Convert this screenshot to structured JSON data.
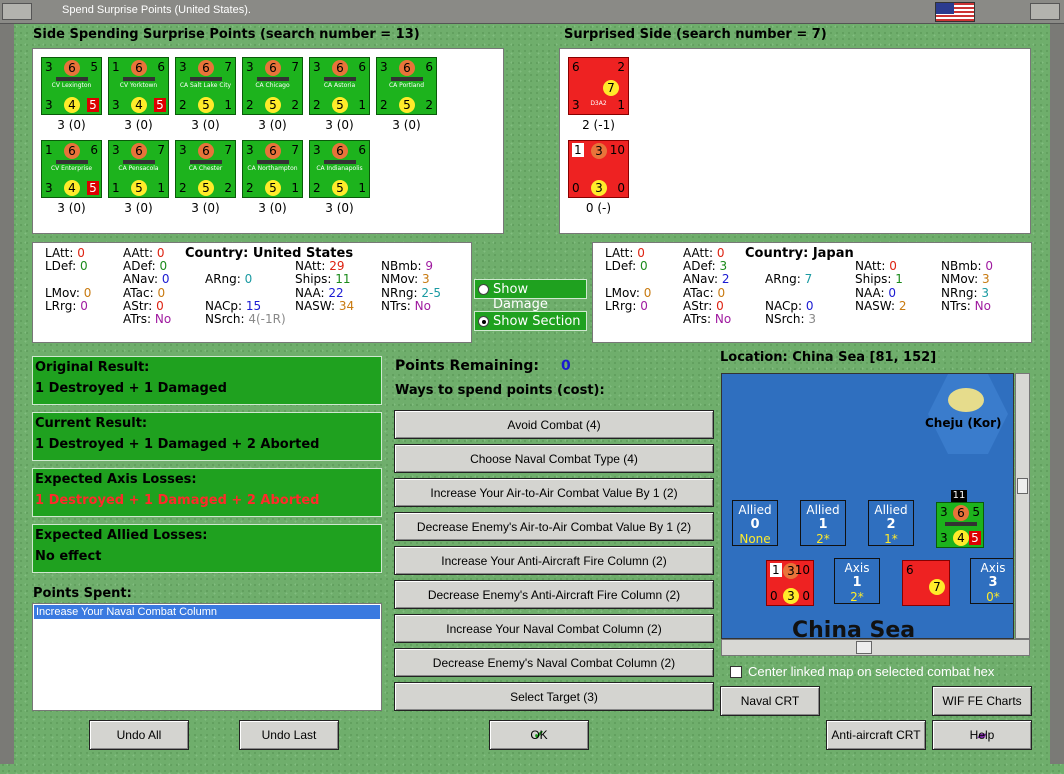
{
  "window": {
    "title": "Spend Surprise Points (United States)."
  },
  "side_spending": {
    "header": "Side Spending Surprise Points (search number = 13)",
    "units": [
      {
        "name": "CV Lexington",
        "tl": "3",
        "mid": "6",
        "tr": "5",
        "bl": "3",
        "bmid": "4",
        "br": "5",
        "label": "3 (0)",
        "red": true
      },
      {
        "name": "CV Yorktown",
        "tl": "1",
        "mid": "6",
        "tr": "6",
        "bl": "3",
        "bmid": "4",
        "br": "5",
        "label": "3 (0)",
        "red": true
      },
      {
        "name": "CA Salt Lake City",
        "tl": "3",
        "mid": "6",
        "tr": "7",
        "bl": "2",
        "bmid": "5",
        "br": "1",
        "label": "3 (0)"
      },
      {
        "name": "CA Chicago",
        "tl": "3",
        "mid": "6",
        "tr": "7",
        "bl": "2",
        "bmid": "5",
        "br": "2",
        "label": "3 (0)"
      },
      {
        "name": "CA Astoria",
        "tl": "3",
        "mid": "6",
        "tr": "6",
        "bl": "2",
        "bmid": "5",
        "br": "1",
        "label": "3 (0)"
      },
      {
        "name": "CA Portland",
        "tl": "3",
        "mid": "6",
        "tr": "6",
        "bl": "2",
        "bmid": "5",
        "br": "2",
        "label": "3 (0)"
      },
      {
        "name": "CV Enterprise",
        "tl": "1",
        "mid": "6",
        "tr": "6",
        "bl": "3",
        "bmid": "4",
        "br": "5",
        "label": "3 (0)",
        "red": true
      },
      {
        "name": "CA Pensacola",
        "tl": "3",
        "mid": "6",
        "tr": "7",
        "bl": "1",
        "bmid": "5",
        "br": "1",
        "label": "3 (0)"
      },
      {
        "name": "CA Chester",
        "tl": "3",
        "mid": "6",
        "tr": "7",
        "bl": "2",
        "bmid": "5",
        "br": "2",
        "label": "3 (0)"
      },
      {
        "name": "CA Northampton",
        "tl": "3",
        "mid": "6",
        "tr": "7",
        "bl": "2",
        "bmid": "5",
        "br": "1",
        "label": "3 (0)"
      },
      {
        "name": "CA Indianapolis",
        "tl": "3",
        "mid": "6",
        "tr": "6",
        "bl": "2",
        "bmid": "5",
        "br": "1",
        "label": "3 (0)"
      }
    ]
  },
  "surprised": {
    "header": "Surprised Side (search number = 7)",
    "units": [
      {
        "name": "D3A2",
        "tl": "6",
        "tr": "2",
        "bl": "3",
        "bmid": "7",
        "br": "1",
        "label": "2 (-1)"
      },
      {
        "name": "",
        "tl": "1",
        "mid": "3",
        "tr": "10",
        "bl": "0",
        "bmid": "3",
        "br": "0",
        "label": "0 (-)"
      }
    ]
  },
  "stats_us": {
    "country_label": "Country:",
    "country": "United States",
    "LAtt": "0",
    "LDef": "0",
    "LMov": "0",
    "LRrg": "0",
    "AAtt": "0",
    "ADef": "0",
    "ANav": "0",
    "ATac": "0",
    "AStr": "0",
    "ATrs": "No",
    "ARng": "0",
    "NACp": "15",
    "NSrch": "4(-1R)",
    "NAtt": "29",
    "Ships": "11",
    "NAA": "22",
    "NASW": "34",
    "NBmb": "9",
    "NMov": "3",
    "NRng": "2-5",
    "NTrs": "No"
  },
  "stats_jp": {
    "country_label": "Country:",
    "country": "Japan",
    "LAtt": "0",
    "LDef": "0",
    "LMov": "0",
    "LRrg": "0",
    "AAtt": "0",
    "ADef": "3",
    "ANav": "2",
    "ATac": "0",
    "AStr": "0",
    "ATrs": "No",
    "ARng": "7",
    "NACp": "0",
    "NSrch": "3",
    "NAtt": "0",
    "Ships": "1",
    "NAA": "0",
    "NASW": "2",
    "NBmb": "0",
    "NMov": "3",
    "NRng": "3",
    "NTrs": "No"
  },
  "labels": {
    "LAtt": "LAtt:",
    "LDef": "LDef:",
    "LMov": "LMov:",
    "LRrg": "LRrg:",
    "AAtt": "AAtt:",
    "ADef": "ADef:",
    "ANav": "ANav:",
    "ATac": "ATac:",
    "AStr": "AStr:",
    "ATrs": "ATrs:",
    "ARng": "ARng:",
    "NACp": "NACp:",
    "NSrch": "NSrch:",
    "NAtt": "NAtt:",
    "Ships": "Ships:",
    "NAA": "NAA:",
    "NASW": "NASW:",
    "NBmb": "NBmb:",
    "NMov": "NMov:",
    "NRng": "NRng:",
    "NTrs": "NTrs:"
  },
  "toggles": {
    "show_damage": "Show Damage",
    "show_section": "Show Section"
  },
  "results": {
    "original_label": "Original Result:",
    "original": "1 Destroyed + 1 Damaged",
    "current_label": "Current Result:",
    "current": "1 Destroyed + 1 Damaged + 2 Aborted",
    "axis_label": "Expected Axis Losses:",
    "axis": "1 Destroyed + 1 Damaged + 2 Aborted",
    "allied_label": "Expected Allied Losses:",
    "allied": "No effect"
  },
  "points_spent": {
    "label": "Points Spent:",
    "items": [
      "Increase Your Naval Combat Column"
    ]
  },
  "points": {
    "remaining_label": "Points Remaining:",
    "remaining": "0",
    "ways_label": "Ways to spend points (cost):"
  },
  "options": [
    "Avoid Combat (4)",
    "Choose Naval Combat Type (4)",
    "Increase Your Air-to-Air Combat Value By 1 (2)",
    "Decrease Enemy's Air-to-Air Combat Value By 1 (2)",
    "Increase Your Anti-Aircraft Fire Column (2)",
    "Decrease Enemy's Anti-Aircraft Fire Column (2)",
    "Increase Your Naval Combat Column (2)",
    "Decrease Enemy's Naval Combat Column (2)",
    "Select Target (3)"
  ],
  "location": {
    "label": "Location: China Sea [81, 152]",
    "hex_name": "Cheju (Kor)",
    "sea_name": "China Sea",
    "allied_boxes": [
      {
        "t": "Allied",
        "n": "0",
        "s": "None"
      },
      {
        "t": "Allied",
        "n": "1",
        "s": "2*"
      },
      {
        "t": "Allied",
        "n": "2",
        "s": "1*"
      }
    ],
    "axis_boxes": [
      {
        "t": "Axis",
        "n": "1",
        "s": "2*"
      },
      {
        "t": "Axis",
        "n": "3",
        "s": "0*"
      }
    ],
    "stack_count": "11"
  },
  "center_linked": "Center linked map on selected combat hex",
  "buttons": {
    "undo_all": "Undo All",
    "undo_last": "Undo Last",
    "ok": "OK",
    "naval_crt": "Naval CRT",
    "wif_charts": "WIF FE Charts",
    "aa_crt": "Anti-aircraft CRT",
    "help": "Help"
  },
  "colors": {
    "panel_green": "#1fa11f",
    "counter_green": "#1db31d",
    "counter_red": "#e22",
    "sea_blue": "#2f6fbf"
  }
}
